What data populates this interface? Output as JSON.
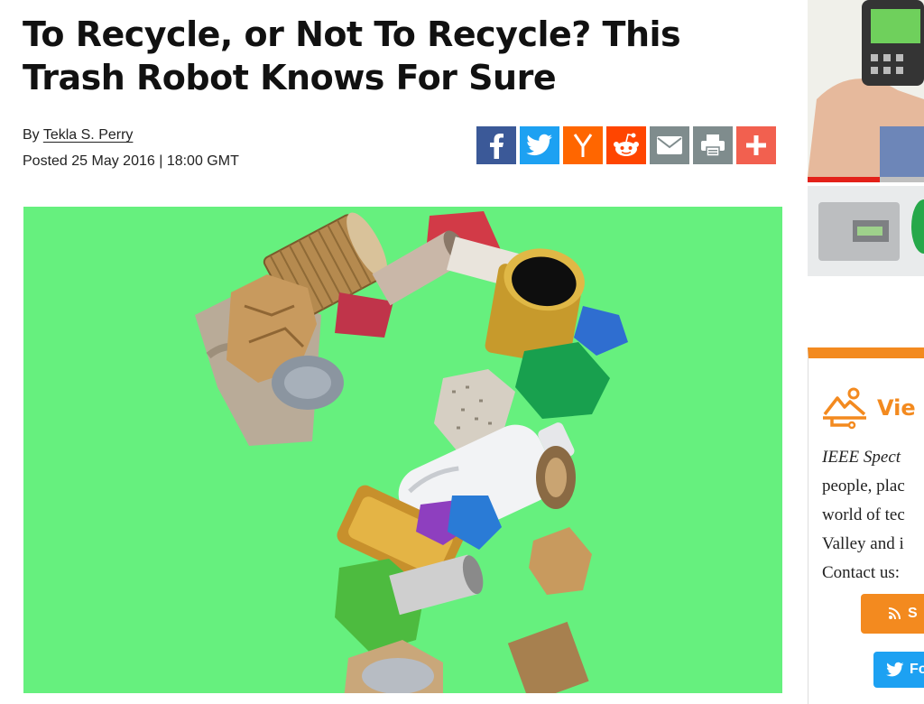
{
  "article": {
    "title": "To Recycle, or Not To Recycle? This Trash Robot Knows For Sure",
    "byline_prefix": "By",
    "author": "Tekla S. Perry",
    "posted": "Posted 25 May 2016 | 18:00 GMT"
  },
  "share_buttons": [
    {
      "name": "facebook",
      "icon": "facebook-icon",
      "color": "#3b5998"
    },
    {
      "name": "twitter",
      "icon": "twitter-icon",
      "color": "#1da1f2"
    },
    {
      "name": "hacker-news",
      "icon": "y-combinator-icon",
      "color": "#ff6600"
    },
    {
      "name": "reddit",
      "icon": "reddit-icon",
      "color": "#ff4500"
    },
    {
      "name": "email",
      "icon": "envelope-icon",
      "color": "#7f8c8d"
    },
    {
      "name": "print",
      "icon": "printer-icon",
      "color": "#7f8c8d"
    },
    {
      "name": "more",
      "icon": "plus-icon",
      "color": "#f2604f"
    }
  ],
  "hero": {
    "background_color": "#66f07e",
    "subject": "question mark made of recyclable trash"
  },
  "sidebar": {
    "about": {
      "heading": "Vie",
      "lines": [
        "IEEE Spect",
        "people, plac",
        "world of tec",
        "Valley and i",
        "Contact us:"
      ],
      "accent_color": "#f38a1f"
    },
    "subscribe_label": "S",
    "follow_label": "Fo"
  }
}
